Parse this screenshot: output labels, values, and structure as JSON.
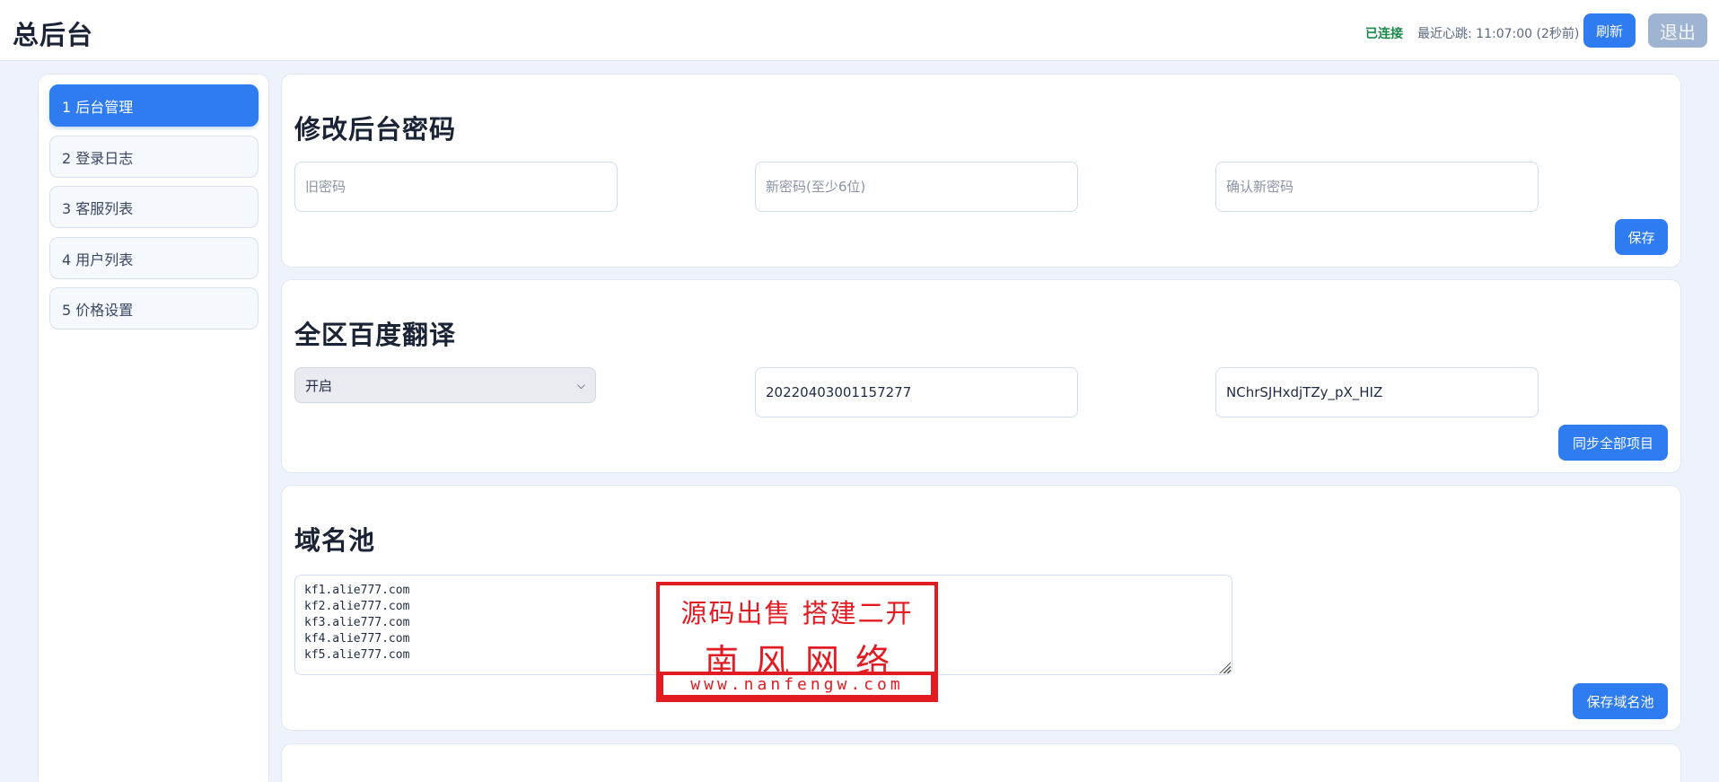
{
  "header": {
    "title": "总后台",
    "status_connected": "已连接",
    "heartbeat": "最近心跳: 11:07:00 (2秒前)",
    "refresh_label": "刷新",
    "logout_label": "退出"
  },
  "sidebar": {
    "items": [
      {
        "label": "1 后台管理",
        "active": true
      },
      {
        "label": "2 登录日志",
        "active": false
      },
      {
        "label": "3 客服列表",
        "active": false
      },
      {
        "label": "4 用户列表",
        "active": false
      },
      {
        "label": "5 价格设置",
        "active": false
      }
    ]
  },
  "password_card": {
    "title": "修改后台密码",
    "old_password_placeholder": "旧密码",
    "new_password_placeholder": "新密码(至少6位)",
    "confirm_password_placeholder": "确认新密码",
    "save_label": "保存"
  },
  "translate_card": {
    "title": "全区百度翻译",
    "toggle_value": "开启",
    "app_id_value": "20220403001157277",
    "secret_value": "NChrSJHxdjTZy_pX_HIZ",
    "sync_label": "同步全部项目"
  },
  "domain_card": {
    "title": "域名池",
    "domains": "kf1.alie777.com\nkf2.alie777.com\nkf3.alie777.com\nkf4.alie777.com\nkf5.alie777.com",
    "save_label": "保存域名池"
  },
  "watermark": {
    "line1": "源码出售 搭建二开",
    "line2": "南风网络",
    "line3": "www.nanfengw.com"
  },
  "colors": {
    "accent": "#2f7bf0",
    "connected": "#1a8a4a",
    "stamp_red": "#e31b23",
    "page_bg": "#eef3fb"
  }
}
